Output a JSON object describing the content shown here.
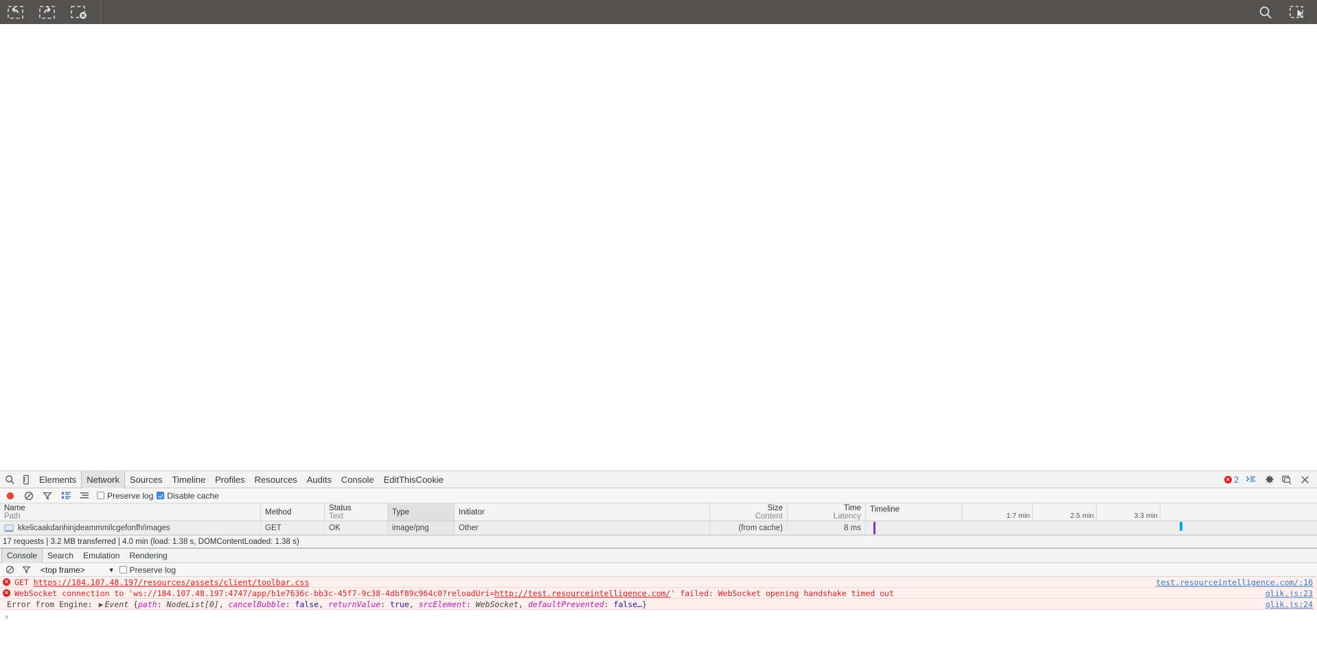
{
  "ext_toolbar": {
    "buttons": [
      {
        "name": "select-region-back-icon",
        "label": ""
      },
      {
        "name": "select-region-forward-icon",
        "label": ""
      },
      {
        "name": "select-region-cancel-icon",
        "label": ""
      }
    ],
    "right_buttons": [
      {
        "name": "search-icon",
        "label": ""
      },
      {
        "name": "capture-selection-icon",
        "label": ""
      }
    ]
  },
  "devtools": {
    "tabs": [
      {
        "label": "Elements",
        "active": false
      },
      {
        "label": "Network",
        "active": true
      },
      {
        "label": "Sources",
        "active": false
      },
      {
        "label": "Timeline",
        "active": false
      },
      {
        "label": "Profiles",
        "active": false
      },
      {
        "label": "Resources",
        "active": false
      },
      {
        "label": "Audits",
        "active": false
      },
      {
        "label": "Console",
        "active": false
      },
      {
        "label": "EditThisCookie",
        "active": false
      }
    ],
    "error_count": "2",
    "right_icons": [
      "console-drawer-icon",
      "gear-icon",
      "dock-icon",
      "close-icon"
    ],
    "left_icons": [
      "inspect-element-icon",
      "device-mode-icon"
    ]
  },
  "network_toolbar": {
    "record_label": "",
    "icons": [
      "record-icon",
      "clear-icon",
      "filter-icon",
      "large-rows-icon",
      "group-by-frame-icon"
    ],
    "preserve_log_label": "Preserve log",
    "preserve_log_checked": false,
    "disable_cache_label": "Disable cache",
    "disable_cache_checked": true
  },
  "network_table": {
    "columns": [
      {
        "title": "Name",
        "sub": "Path",
        "sorted": false
      },
      {
        "title": "Method",
        "sub": "",
        "sorted": false
      },
      {
        "title": "Status",
        "sub": "Text",
        "sorted": false
      },
      {
        "title": "Type",
        "sub": "",
        "sorted": true
      },
      {
        "title": "Initiator",
        "sub": "",
        "sorted": false
      },
      {
        "title": "Size",
        "sub": "Content",
        "sorted": false
      },
      {
        "title": "Time",
        "sub": "Latency",
        "sorted": false
      },
      {
        "title": "Timeline",
        "sub": "",
        "sorted": false
      }
    ],
    "timeline_ticks": [
      "1.7 min",
      "2.5 min",
      "3.3 min"
    ],
    "rows": [
      {
        "name": "kkelicaakdanhinjdeammmilcgefonfh/images",
        "icon": "image-file-icon",
        "method": "GET",
        "status": "OK",
        "type": "image/png",
        "initiator": "Other",
        "size": "(from cache)",
        "time": "8 ms"
      }
    ]
  },
  "network_summary": "17 requests | 3.2 MB transferred | 4.0 min (load: 1.38 s, DOMContentLoaded: 1.38 s)",
  "drawer": {
    "tabs": [
      {
        "label": "Console",
        "active": true
      },
      {
        "label": "Search",
        "active": false
      },
      {
        "label": "Emulation",
        "active": false
      },
      {
        "label": "Rendering",
        "active": false
      }
    ],
    "console_toolbar": {
      "icons": [
        "clear-console-icon",
        "filter-icon"
      ],
      "frame_value": "<top frame>",
      "dropdown_arrow": "▼",
      "preserve_log_label": "Preserve log",
      "preserve_log_checked": false
    },
    "messages": [
      {
        "level": "error",
        "prefix": "GET ",
        "link": "https://184.107.48.197/resources/assets/client/toolbar.css",
        "suffix": "",
        "source": "test.resourceintelligence.com/:16"
      },
      {
        "level": "error",
        "prefix": "WebSocket connection to 'ws://184.107.48.197:4747/app/b1e7636c-bb3c-45f7-9c38-4dbf89c964c0?reloadUri=",
        "link": "http://test.resourceintelligence.com/",
        "suffix": "' failed: WebSocket opening handshake timed out",
        "source": "qlik.js:23"
      },
      {
        "level": "object",
        "text_prefix": "Error from Engine: ",
        "disclosure": "▶",
        "object_name": "Event ",
        "object_body": [
          {
            "key": "path",
            "value": "NodeList[0]",
            "value_kind": "neutral"
          },
          {
            "key": "cancelBubble",
            "value": "false",
            "value_kind": "bool"
          },
          {
            "key": "returnValue",
            "value": "true",
            "value_kind": "bool"
          },
          {
            "key": "srcElement",
            "value": "WebSocket",
            "value_kind": "neutral"
          },
          {
            "key": "defaultPrevented",
            "value": "false…",
            "value_kind": "bool"
          }
        ],
        "source": "qlik.js:24"
      }
    ],
    "prompt_symbol": "›"
  },
  "colors": {
    "toolbar_bg": "#545250",
    "error_red": "#e02020",
    "link_blue": "#3b78c8",
    "accent_blue": "#3b8eea",
    "timeline_purple": "#8a2be2",
    "timeline_cyan": "#00a8f0",
    "record_red": "#e8443a"
  }
}
